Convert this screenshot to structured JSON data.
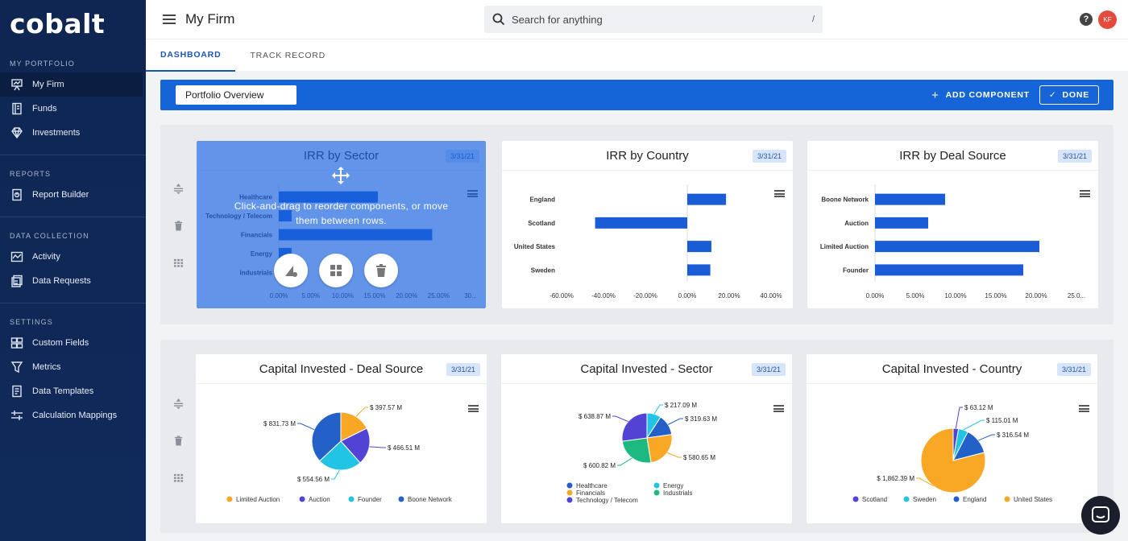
{
  "app": {
    "logo": "cobalt"
  },
  "sidebar": {
    "sections": [
      {
        "label": "MY PORTFOLIO",
        "items": [
          {
            "label": "My Firm",
            "icon": "presentation-icon",
            "active": true
          },
          {
            "label": "Funds",
            "icon": "ledger-icon"
          },
          {
            "label": "Investments",
            "icon": "diamond-icon"
          }
        ]
      },
      {
        "label": "REPORTS",
        "items": [
          {
            "label": "Report Builder",
            "icon": "report-icon"
          }
        ]
      },
      {
        "label": "DATA COLLECTION",
        "items": [
          {
            "label": "Activity",
            "icon": "activity-icon"
          },
          {
            "label": "Data Requests",
            "icon": "requests-icon"
          }
        ]
      },
      {
        "label": "SETTINGS",
        "items": [
          {
            "label": "Custom Fields",
            "icon": "fields-icon"
          },
          {
            "label": "Metrics",
            "icon": "metrics-icon"
          },
          {
            "label": "Data Templates",
            "icon": "templates-icon"
          },
          {
            "label": "Calculation Mappings",
            "icon": "mappings-icon"
          }
        ]
      }
    ]
  },
  "header": {
    "title": "My Firm",
    "search_placeholder": "Search for anything",
    "search_shortcut": "/",
    "help": "?",
    "avatar": "KF"
  },
  "tabs": [
    {
      "label": "DASHBOARD",
      "active": true
    },
    {
      "label": "TRACK RECORD",
      "active": false
    }
  ],
  "toolbar": {
    "view": "Portfolio Overview",
    "add_component": "ADD COMPONENT",
    "done": "DONE"
  },
  "drag_hint": "Click-and-drag to reorder components, or move them between rows.",
  "colors": {
    "accent": "#1565d8",
    "bar": "#1a5bd6",
    "pie": [
      "#f9a825",
      "#5143d4",
      "#22c4e6",
      "#2360c8",
      "#1eb980"
    ]
  },
  "chart_data": [
    {
      "type": "bar",
      "orientation": "horizontal",
      "title": "IRR by Sector",
      "date": "3/31/21",
      "categories": [
        "Healthcare",
        "Technology / Telecom",
        "Financials",
        "Energy",
        "Industrials"
      ],
      "values": [
        15.5,
        2.0,
        24.0,
        2.0,
        3.0
      ],
      "xticks": [
        "0.00%",
        "5.00%",
        "10.00%",
        "15.00%",
        "20.00%",
        "25.00%",
        "30..."
      ],
      "xlim": [
        0,
        30
      ]
    },
    {
      "type": "bar",
      "orientation": "horizontal",
      "title": "IRR by Country",
      "date": "3/31/21",
      "categories": [
        "England",
        "Scotland",
        "United States",
        "Sweden"
      ],
      "values": [
        18.5,
        -44.0,
        11.5,
        11.0
      ],
      "xticks": [
        "-60.00%",
        "-40.00%",
        "-20.00%",
        "0.00%",
        "20.00%",
        "40.00%"
      ],
      "xlim": [
        -60,
        40
      ]
    },
    {
      "type": "bar",
      "orientation": "horizontal",
      "title": "IRR by Deal Source",
      "date": "3/31/21",
      "categories": [
        "Boone Network",
        "Auction",
        "Limited Auction",
        "Founder"
      ],
      "values": [
        8.7,
        6.6,
        20.4,
        18.4
      ],
      "xticks": [
        "0.00%",
        "5.00%",
        "10.00%",
        "15.00%",
        "20.00%",
        "25.0..."
      ],
      "xlim": [
        0,
        25
      ]
    },
    {
      "type": "pie",
      "title": "Capital Invested - Deal Source",
      "date": "3/31/21",
      "slices": [
        {
          "name": "Limited Auction",
          "value": 397.57,
          "label": "$ 397.57 M",
          "color": "#f9a825"
        },
        {
          "name": "Auction",
          "value": 466.51,
          "label": "$ 466.51 M",
          "color": "#5143d4"
        },
        {
          "name": "Founder",
          "value": 554.56,
          "label": "$ 554.56 M",
          "color": "#22c4e6"
        },
        {
          "name": "Boone Network",
          "value": 831.73,
          "label": "$ 831.73 M",
          "color": "#2360c8"
        }
      ]
    },
    {
      "type": "pie",
      "title": "Capital Invested - Sector",
      "date": "3/31/21",
      "slices": [
        {
          "name": "Energy",
          "value": 217.09,
          "label": "$ 217.09 M",
          "color": "#22c4e6"
        },
        {
          "name": "Healthcare",
          "value": 319.63,
          "label": "$ 319.63 M",
          "color": "#2360c8"
        },
        {
          "name": "Financials",
          "value": 580.65,
          "label": "$ 580.65 M",
          "color": "#f9a825"
        },
        {
          "name": "Industrials",
          "value": 600.82,
          "label": "$ 600.82 M",
          "color": "#1eb980"
        },
        {
          "name": "Technology / Telecom",
          "value": 638.87,
          "label": "$ 638.87 M",
          "color": "#5143d4"
        }
      ],
      "legend_order": [
        "Healthcare",
        "Energy",
        "Financials",
        "Industrials",
        "Technology / Telecom"
      ]
    },
    {
      "type": "pie",
      "title": "Capital Invested - Country",
      "date": "3/31/21",
      "slices": [
        {
          "name": "Scotland",
          "value": 63.12,
          "label": "$ 63.12 M",
          "color": "#5143d4"
        },
        {
          "name": "Sweden",
          "value": 115.01,
          "label": "$ 115.01 M",
          "color": "#22c4e6"
        },
        {
          "name": "England",
          "value": 316.54,
          "label": "$ 316.54 M",
          "color": "#2360c8"
        },
        {
          "name": "United States",
          "value": 1862.39,
          "label": "$ 1,862.39 M",
          "color": "#f9a825"
        }
      ]
    }
  ]
}
